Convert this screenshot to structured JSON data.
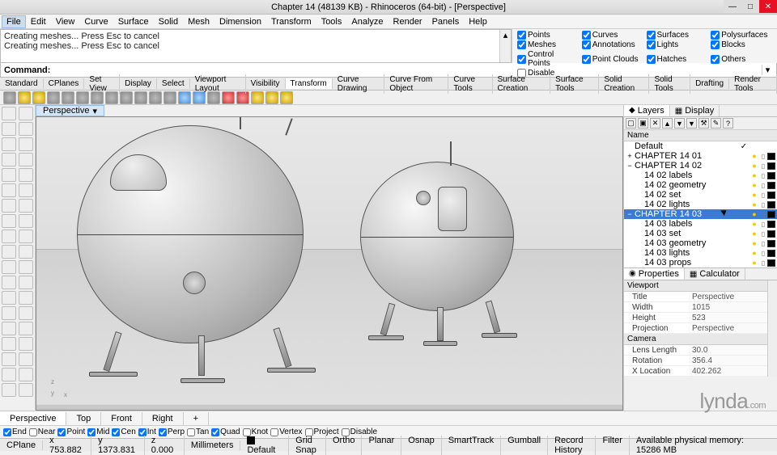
{
  "title": "Chapter 14 (48139 KB) - Rhinoceros (64-bit) - [Perspective]",
  "menu": [
    "File",
    "Edit",
    "View",
    "Curve",
    "Surface",
    "Solid",
    "Mesh",
    "Dimension",
    "Transform",
    "Tools",
    "Analyze",
    "Render",
    "Panels",
    "Help"
  ],
  "menu_selected_index": 0,
  "command_history": [
    "Creating meshes... Press Esc to cancel",
    "Creating meshes... Press Esc to cancel"
  ],
  "command_label": "Command:",
  "object_options": {
    "row1": [
      [
        "Points",
        true
      ],
      [
        "Curves",
        true
      ],
      [
        "Surfaces",
        true
      ],
      [
        "Polysurfaces",
        true
      ],
      [
        "Meshes",
        true
      ]
    ],
    "row2": [
      [
        "Annotations",
        true
      ],
      [
        "Lights",
        true
      ],
      [
        "Blocks",
        true
      ],
      [
        "Control Points",
        true
      ],
      [
        "Point Clouds",
        true
      ]
    ],
    "row3": [
      [
        "Hatches",
        true
      ],
      [
        "Others",
        true
      ],
      [
        "Disable",
        false
      ]
    ]
  },
  "tabs": [
    "Standard",
    "CPlanes",
    "Set View",
    "Display",
    "Select",
    "Viewport Layout",
    "Visibility",
    "Transform",
    "Curve Drawing",
    "Curve From Object",
    "Curve Tools",
    "Surface Creation",
    "Surface Tools",
    "Solid Creation",
    "Solid Tools",
    "Drafting",
    "Render Tools"
  ],
  "tabs_active_index": 7,
  "viewport_label": "Perspective",
  "right_tabs": {
    "layers": "Layers",
    "display": "Display"
  },
  "layer_header": "Name",
  "layers": [
    {
      "exp": "",
      "indent": 0,
      "name": "Default",
      "check": true,
      "sel": false
    },
    {
      "exp": "+",
      "indent": 0,
      "name": "CHAPTER 14 01",
      "check": false,
      "sel": false
    },
    {
      "exp": "−",
      "indent": 0,
      "name": "CHAPTER 14 02",
      "check": false,
      "sel": false
    },
    {
      "exp": "",
      "indent": 1,
      "name": "14 02 labels",
      "check": false,
      "sel": false
    },
    {
      "exp": "",
      "indent": 1,
      "name": "14 02 geometry",
      "check": false,
      "sel": false
    },
    {
      "exp": "",
      "indent": 1,
      "name": "14 02 set",
      "check": false,
      "sel": false
    },
    {
      "exp": "",
      "indent": 1,
      "name": "14 02 lights",
      "check": false,
      "sel": false
    },
    {
      "exp": "−",
      "indent": 0,
      "name": "CHAPTER 14 03",
      "check": false,
      "sel": true
    },
    {
      "exp": "",
      "indent": 1,
      "name": "14 03 labels",
      "check": false,
      "sel": false
    },
    {
      "exp": "",
      "indent": 1,
      "name": "14 03 set",
      "check": false,
      "sel": false
    },
    {
      "exp": "",
      "indent": 1,
      "name": "14 03 geometry",
      "check": false,
      "sel": false
    },
    {
      "exp": "",
      "indent": 1,
      "name": "14 03 lights",
      "check": false,
      "sel": false
    },
    {
      "exp": "",
      "indent": 1,
      "name": "14 03 props",
      "check": false,
      "sel": false
    }
  ],
  "props_tabs": {
    "properties": "Properties",
    "calculator": "Calculator"
  },
  "props": {
    "group1": "Viewport",
    "rows1": [
      [
        "Title",
        "Perspective"
      ],
      [
        "Width",
        "1015"
      ],
      [
        "Height",
        "523"
      ],
      [
        "Projection",
        "Perspective"
      ]
    ],
    "group2": "Camera",
    "rows2": [
      [
        "Lens Length",
        "30.0"
      ],
      [
        "Rotation",
        "356.4"
      ],
      [
        "X Location",
        "402.262"
      ]
    ]
  },
  "vp_bottom_tabs": [
    "Perspective",
    "Top",
    "Front",
    "Right",
    "+"
  ],
  "vp_bottom_active": 0,
  "osnaps": [
    [
      "End",
      true
    ],
    [
      "Near",
      false
    ],
    [
      "Point",
      true
    ],
    [
      "Mid",
      true
    ],
    [
      "Cen",
      true
    ],
    [
      "Int",
      true
    ],
    [
      "Perp",
      true
    ],
    [
      "Tan",
      false
    ],
    [
      "Quad",
      true
    ],
    [
      "Knot",
      false
    ],
    [
      "Vertex",
      false
    ],
    [
      "Project",
      false
    ],
    [
      "Disable",
      false
    ]
  ],
  "status": {
    "cplane": "CPlane",
    "x": "x 753.882",
    "y": "y 1373.831",
    "z": "z 0.000",
    "units": "Millimeters",
    "layer": "Default",
    "toggles": [
      "Grid Snap",
      "Ortho",
      "Planar",
      "Osnap",
      "SmartTrack",
      "Gumball",
      "Record History",
      "Filter"
    ],
    "memory": "Available physical memory: 15286 MB"
  },
  "watermark": "lynda.com"
}
